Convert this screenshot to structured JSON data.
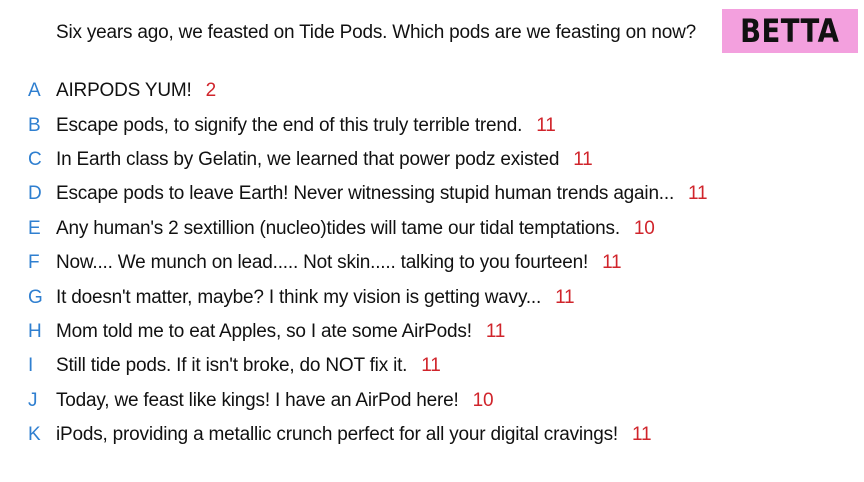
{
  "prompt": "Six years ago, we feasted on Tide Pods. Which pods are we feasting on now?",
  "badge": "BETTA",
  "colors": {
    "letter": "#2f7fd0",
    "score": "#d0242b",
    "badge_bg": "#f3a0de",
    "text": "#111111"
  },
  "answers": [
    {
      "letter": "A",
      "text": "AIRPODS YUM!",
      "score": "2"
    },
    {
      "letter": "B",
      "text": "Escape pods, to signify the end of this truly terrible trend.",
      "score": "11"
    },
    {
      "letter": "C",
      "text": "In Earth class by Gelatin, we learned that power podz existed",
      "score": "11"
    },
    {
      "letter": "D",
      "text": "Escape pods to leave Earth! Never witnessing stupid human trends again...",
      "score": "11"
    },
    {
      "letter": "E",
      "text": "Any human's 2 sextillion (nucleo)tides will tame our tidal temptations.",
      "score": "10"
    },
    {
      "letter": "F",
      "text": "Now.... We munch on lead..... Not skin..... talking to you fourteen!",
      "score": "11"
    },
    {
      "letter": "G",
      "text": "It doesn't matter, maybe? I think my vision is getting wavy...",
      "score": "11"
    },
    {
      "letter": "H",
      "text": "Mom told me to eat Apples, so I ate some AirPods!",
      "score": "11"
    },
    {
      "letter": "I",
      "text": "Still tide pods. If it isn't broke, do NOT fix it.",
      "score": "11"
    },
    {
      "letter": "J",
      "text": "Today, we feast like kings! I have an AirPod here!",
      "score": "10"
    },
    {
      "letter": "K",
      "text": "iPods, providing a metallic crunch perfect for all your digital cravings!",
      "score": "11"
    }
  ]
}
